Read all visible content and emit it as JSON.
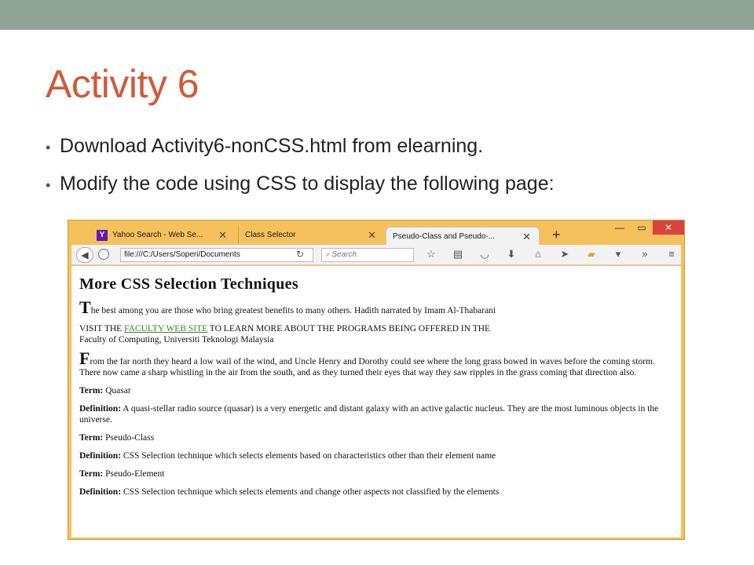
{
  "slide": {
    "title": "Activity 6",
    "bullets": [
      "Download Activity6-nonCSS.html from elearning.",
      "Modify the code using CSS to display the following page:"
    ]
  },
  "browser": {
    "tabs": [
      {
        "label": "Yahoo Search - Web Se...",
        "icon": "yahoo-icon"
      },
      {
        "label": "Class Selector"
      },
      {
        "label": "Pseudo-Class and Pseudo-...",
        "active": true
      }
    ],
    "tab_close": "✕",
    "new_tab": "+",
    "window": {
      "minimize": "—",
      "maximize": "▭",
      "close": "✕"
    },
    "url": "file:///C:/Users/Soperi/Documents",
    "search_placeholder": "Search",
    "toolbar_icons": [
      "star-icon",
      "clipboard-icon",
      "pocket-icon",
      "download-icon",
      "home-icon",
      "send-icon",
      "folder-icon",
      "dropdown-icon",
      "overflow-icon",
      "menu-icon"
    ]
  },
  "page": {
    "heading": "More CSS Selection Techniques",
    "p1_dropcap": "T",
    "p1_text": "he best among you are those who bring greatest benefits to many others. Hadith narrated by Imam Al-Thabarani",
    "p2_before": "VISIT THE ",
    "p2_link": "FACULTY WEB SITE",
    "p2_after": " TO LEARN MORE ABOUT THE PROGRAMS BEING OFFERED IN THE",
    "p2_line2": "Faculty of Computing, Universiti Teknologi Malaysia",
    "p3_dropcap": "F",
    "p3_text": "rom the far north they heard a low wail of the wind, and Uncle Henry and Dorothy could see where the long grass bowed in waves before the coming storm. There now came a sharp whistling in the air from the south, and as they turned their eyes that way they saw ripples in the grass coming that direction also.",
    "terms": [
      {
        "term_label": "Term:",
        "term": "Quasar",
        "def_label": "Definition:",
        "def": "A quasi-stellar radio source (quasar) is a very energetic and distant galaxy with an active galactic nucleus. They are the most luminous objects in the universe."
      },
      {
        "term_label": "Term:",
        "term": "Pseudo-Class",
        "def_label": "Definition:",
        "def": "CSS Selection technique which selects elements based on characteristics other than their element name"
      },
      {
        "term_label": "Term:",
        "term": "Pseudo-Element",
        "def_label": "Definition:",
        "def": "CSS Selection technique which selects elements and change other aspects not classified by the elements"
      }
    ]
  },
  "colors": {
    "title": "#d15a3a",
    "top_bar": "#8fa396",
    "browser_frame": "#f5c15c",
    "link": "#2e8b2e"
  }
}
